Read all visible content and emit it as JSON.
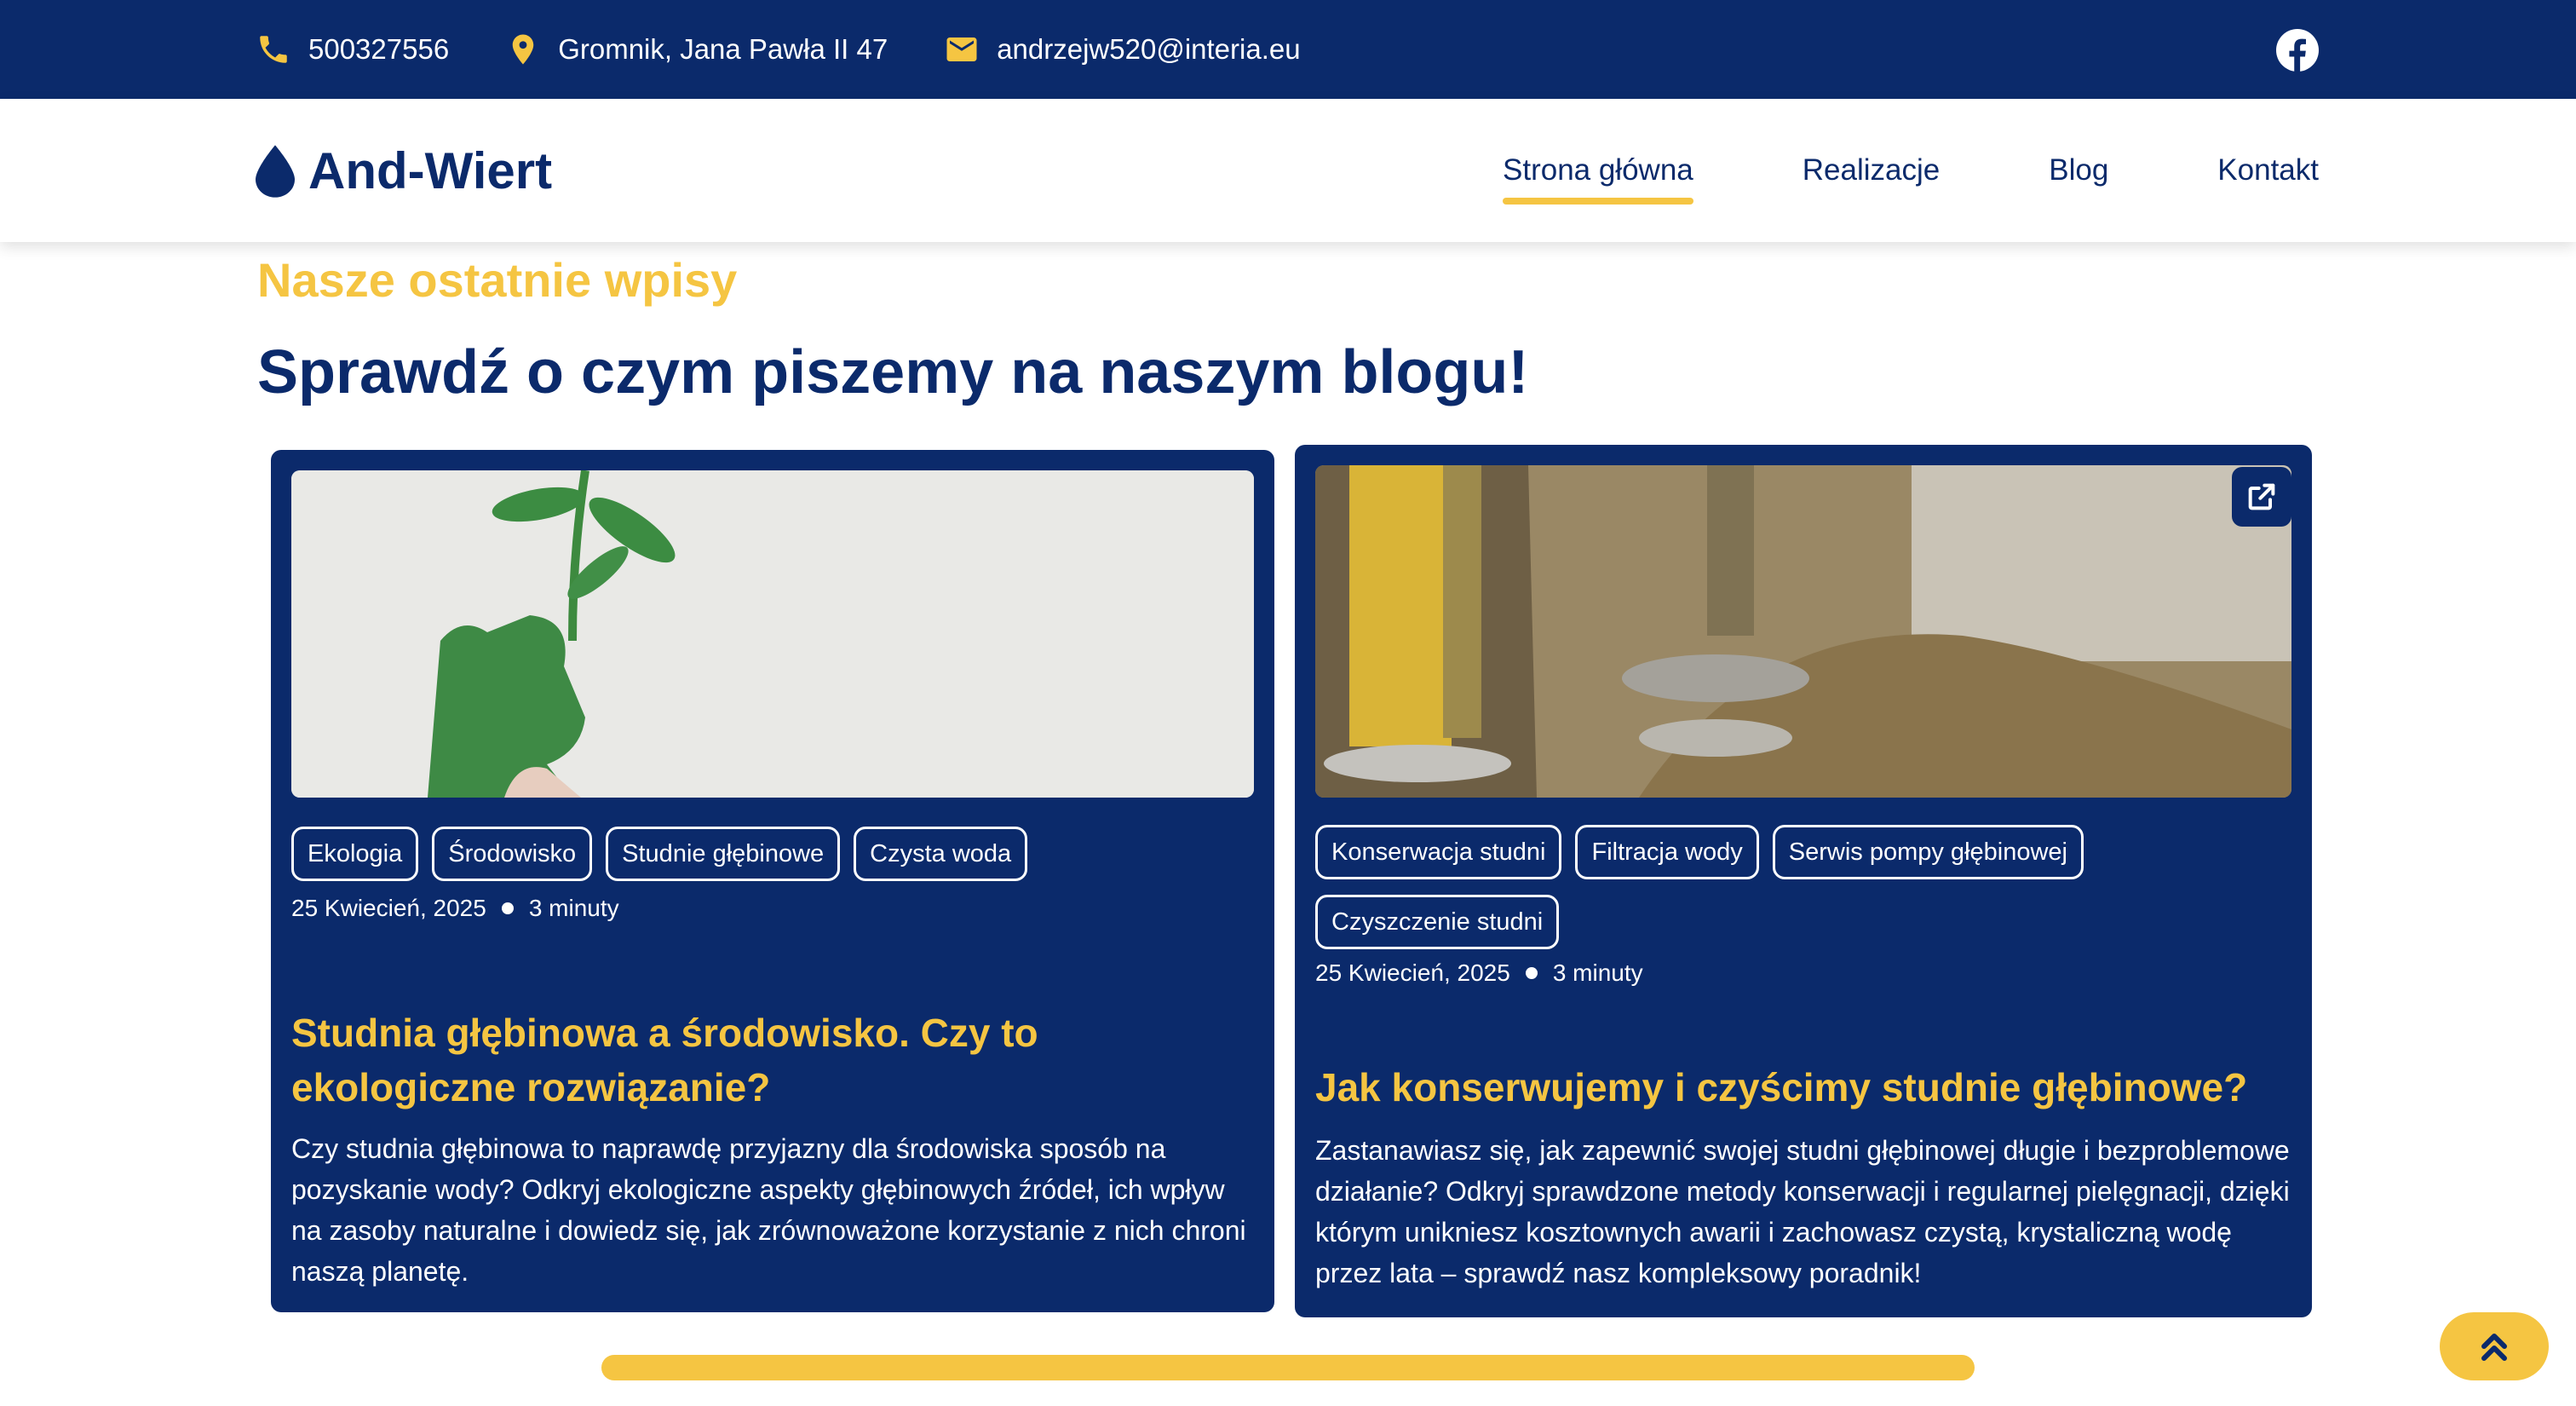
{
  "topbar": {
    "phone": "500327556",
    "address": "Gromnik, Jana Pawła II 47",
    "email": "andrzejw520@interia.eu",
    "phone_icon": "phone-icon",
    "address_icon": "map-pin-icon",
    "email_icon": "envelope-icon",
    "social_icon": "facebook-icon"
  },
  "brand": {
    "name": "And-Wiert",
    "icon": "water-drop-icon"
  },
  "nav": {
    "items": [
      {
        "label": "Strona główna",
        "active": true
      },
      {
        "label": "Realizacje",
        "active": false
      },
      {
        "label": "Blog",
        "active": false
      },
      {
        "label": "Kontakt",
        "active": false
      }
    ]
  },
  "section": {
    "eyebrow": "Nasze ostatnie wpisy",
    "heading": "Sprawdź o czym piszemy na naszym blogu!"
  },
  "posts": [
    {
      "tags": [
        "Ekologia",
        "Środowisko",
        "Studnie głębinowe",
        "Czysta woda"
      ],
      "date": "25 Kwiecień, 2025",
      "read_time": "3 minuty",
      "title": "Studnia głębinowa a środowisko. Czy to ekologiczne rozwiązanie?",
      "excerpt": "Czy studnia głębinowa to naprawdę przyjazny dla środowiska sposób na pozyskanie wody? Odkryj ekologiczne aspekty głębinowych źródeł, ich wpływ na zasoby naturalne i dowiedz się, jak zrównoważone korzystanie z nich chroni naszą planetę."
    },
    {
      "tags": [
        "Konserwacja studni",
        "Filtracja wody",
        "Serwis pompy głębinowej",
        "Czyszczenie studni"
      ],
      "date": "25 Kwiecień, 2025",
      "read_time": "3 minuty",
      "title": "Jak konserwujemy i czyścimy studnie głębinowe?",
      "excerpt": "Zastanawiasz się, jak zapewnić swojej studni głębinowej długie i bezproblemowe działanie? Odkryj sprawdzone metody konserwacji i regularnej pielęgnacji, dzięki którym unikniesz kosztownych awarii i zachowasz czystą, krystaliczną wodę przez lata – sprawdź nasz kompleksowy poradnik!",
      "external_icon": "external-link-icon"
    }
  ],
  "colors": {
    "navy": "#0b2a6b",
    "yellow": "#f5c542",
    "white": "#ffffff"
  },
  "scroll_top_icon": "chevron-double-up-icon"
}
